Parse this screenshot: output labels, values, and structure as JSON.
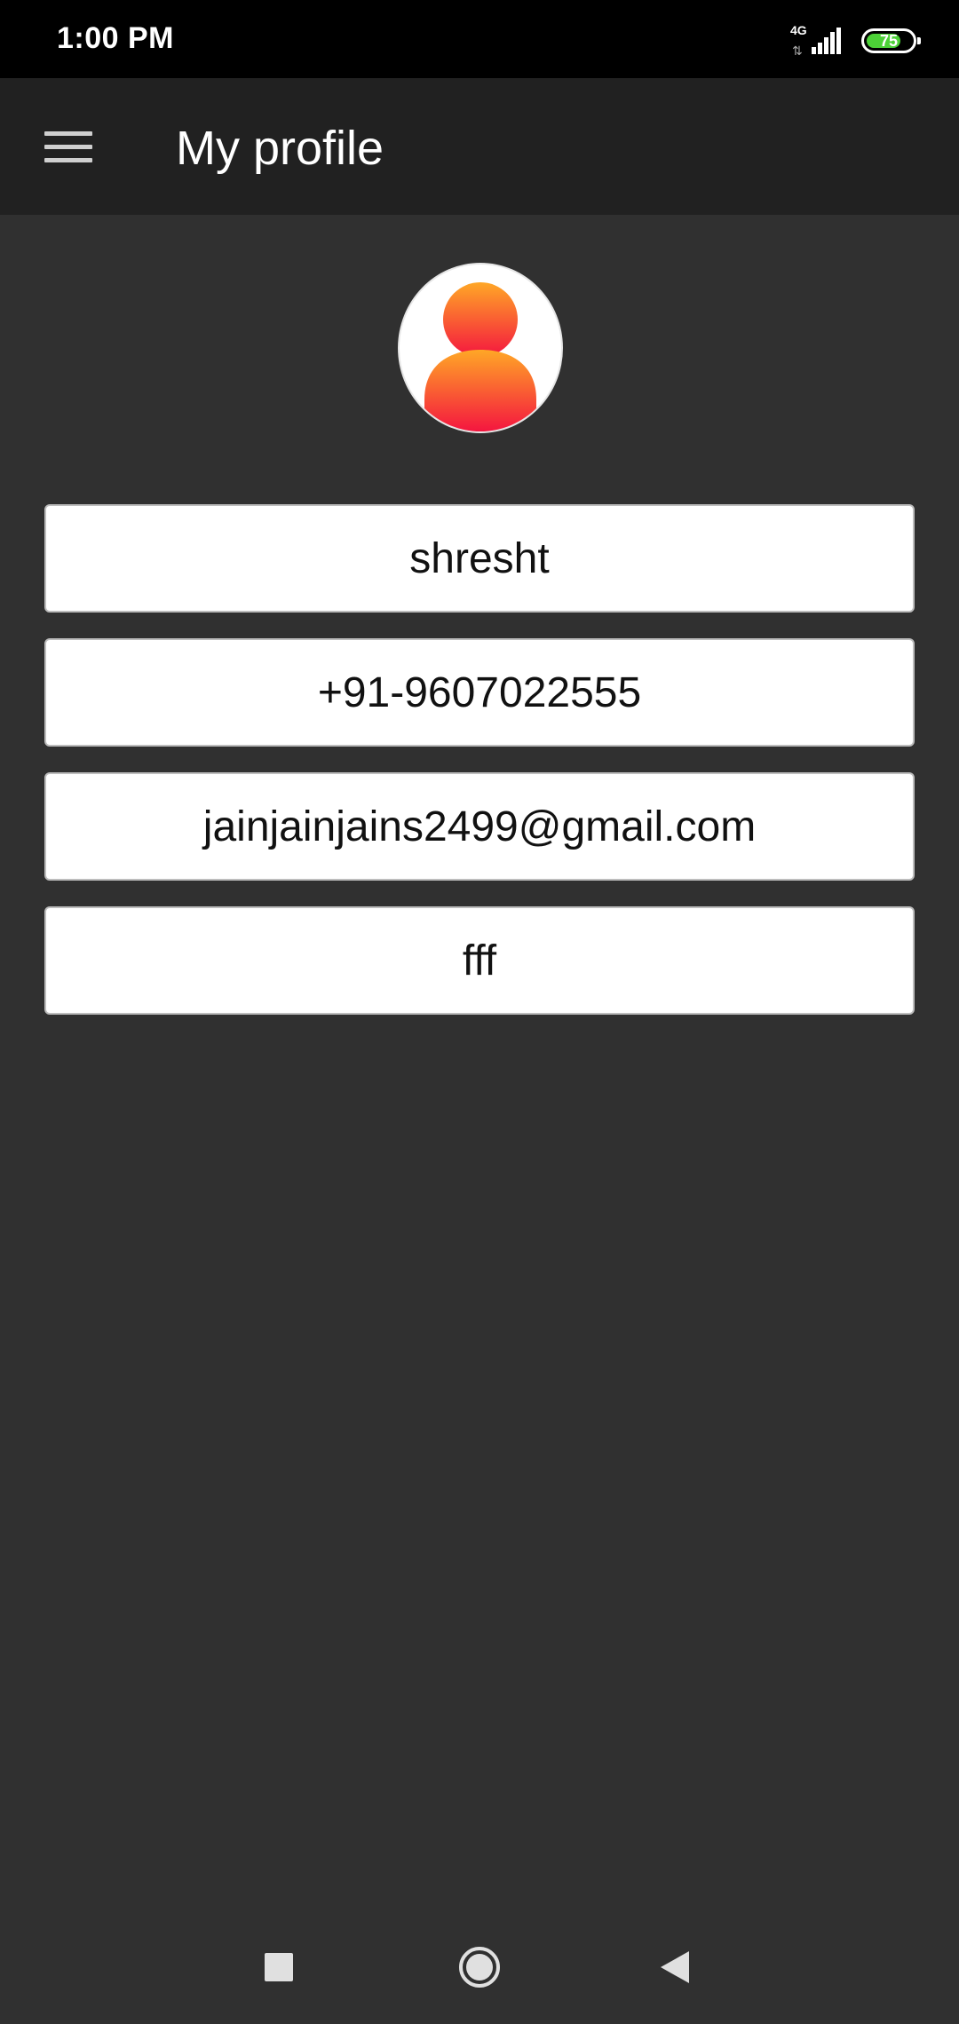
{
  "status_bar": {
    "time": "1:00 PM",
    "network_type": "4G",
    "network_arrows": "⇅",
    "battery_level": "75",
    "battery_fraction": 0.75,
    "battery_color": "#4cd137"
  },
  "app_bar": {
    "title": "My profile",
    "menu_icon": "hamburger-menu-icon",
    "background": "#212121"
  },
  "profile": {
    "avatar_icon": "user-avatar-icon",
    "fields": {
      "name": "shresht",
      "phone": "+91-9607022555",
      "email": "jainjainjains2499@gmail.com",
      "extra": "fff"
    }
  },
  "nav_bar": {
    "recents_icon": "square-recents-icon",
    "home_icon": "circle-home-icon",
    "back_icon": "triangle-back-icon"
  },
  "colors": {
    "page_background": "#303030",
    "status_bar": "#000000",
    "field_background": "#ffffff",
    "avatar_gradient_top": "#ffa726",
    "avatar_gradient_bottom": "#f4163f"
  }
}
